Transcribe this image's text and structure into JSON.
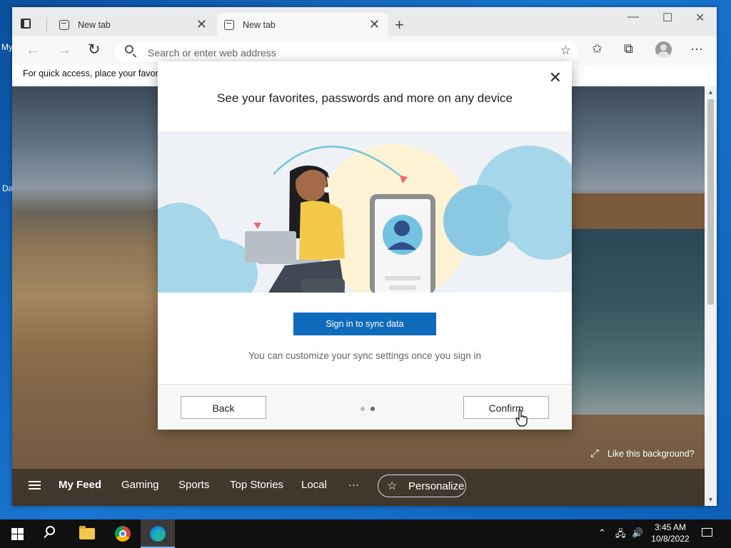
{
  "desktop": {
    "icon1_label": "My",
    "icon2_label": "Da"
  },
  "browser": {
    "tabs": [
      {
        "label": "New tab",
        "close": "✕"
      },
      {
        "label": "New tab",
        "close": "✕"
      }
    ],
    "new_tab": "+",
    "window_controls": {
      "minimize": "—",
      "maximize": "☐",
      "close": "✕"
    },
    "address": {
      "placeholder": "Search or enter web address",
      "value": ""
    },
    "favorites_bar_text": "For quick access, place your favorit"
  },
  "dialog": {
    "title": "See your favorites, passwords and more on any device",
    "close": "✕",
    "primary_button": "Sign in to sync data",
    "note": "You can customize your sync settings once you sign in",
    "back_button": "Back",
    "confirm_button": "Confirm",
    "page_indicator": {
      "total": 2,
      "current": 2
    }
  },
  "ntp": {
    "like_background": "Like this background?",
    "feed": [
      "My Feed",
      "Gaming",
      "Sports",
      "Top Stories",
      "Local"
    ],
    "more": "···",
    "personalize": "Personalize"
  },
  "taskbar": {
    "time": "3:45 AM",
    "date": "10/8/2022",
    "apps": [
      "file-explorer",
      "chrome",
      "edge"
    ]
  },
  "colors": {
    "accent": "#0f6cbd",
    "taskbar": "#101010"
  }
}
